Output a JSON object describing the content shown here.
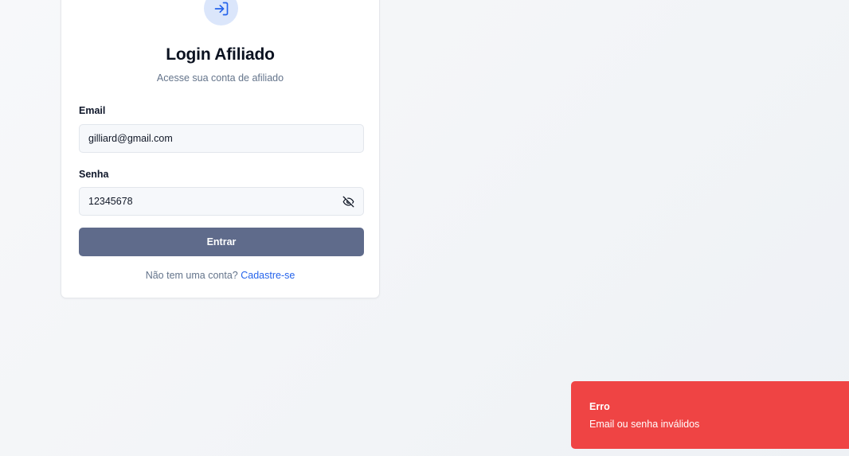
{
  "login": {
    "title": "Login Afiliado",
    "subtitle": "Acesse sua conta de afiliado",
    "email_label": "Email",
    "email_value": "gilliard@gmail.com",
    "password_label": "Senha",
    "password_value": "12345678",
    "submit_label": "Entrar",
    "signup_prompt": "Não tem uma conta?",
    "signup_link": "Cadastre-se"
  },
  "icons": {
    "header": "login-arrow-icon",
    "password_toggle": "eye-off-icon"
  },
  "toast": {
    "title": "Erro",
    "message": "Email ou senha inválidos"
  },
  "colors": {
    "accent": "#2563eb",
    "button": "#5f6b8b",
    "toast_error": "#ef4444",
    "icon_bg": "#dbe6fb"
  }
}
